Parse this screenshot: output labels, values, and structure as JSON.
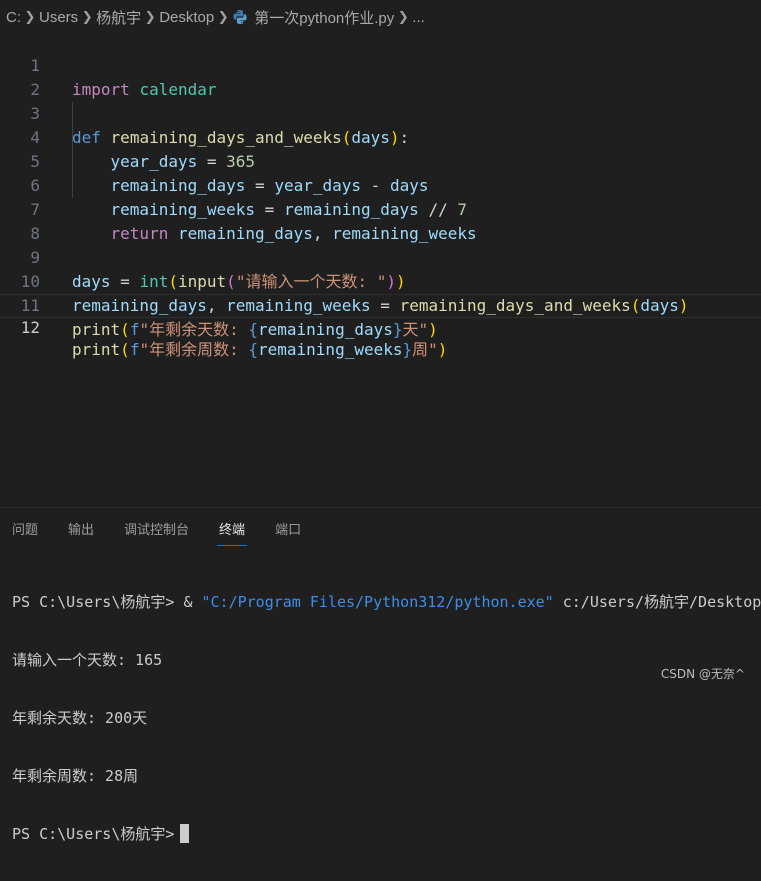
{
  "breadcrumb": {
    "items": [
      "C:",
      "Users",
      "杨航宇",
      "Desktop"
    ],
    "file": "第一次python作业.py",
    "more": "..."
  },
  "editor": {
    "line_numbers": [
      "1",
      "2",
      "3",
      "4",
      "5",
      "6",
      "7",
      "8",
      "9",
      "10",
      "11",
      "12"
    ],
    "active_line": "12"
  },
  "panel": {
    "tabs": [
      "问题",
      "输出",
      "调试控制台",
      "终端",
      "端口"
    ],
    "active_tab": "终端"
  },
  "terminal": {
    "cmd_prompt": "PS C:\\Users\\杨航宇> ",
    "cmd_amp": "& ",
    "cmd_exe": "\"C:/Program Files/Python312/python.exe\"",
    "cmd_arg": " c:/Users/杨航宇/Desktop/第一次python作业.py",
    "out1": "请输入一个天数: 165",
    "out2": "年剩余天数: 200天",
    "out3": "年剩余周数: 28周",
    "final_prompt": "PS C:\\Users\\杨航宇>"
  },
  "watermark": "CSDN @无奈^",
  "colors": {
    "keyword": "#569cd6",
    "control": "#c586c0",
    "function": "#dcdcaa",
    "variable": "#9cdcfe",
    "string": "#ce9178",
    "number": "#b5cea8",
    "module": "#4ec9b0"
  }
}
